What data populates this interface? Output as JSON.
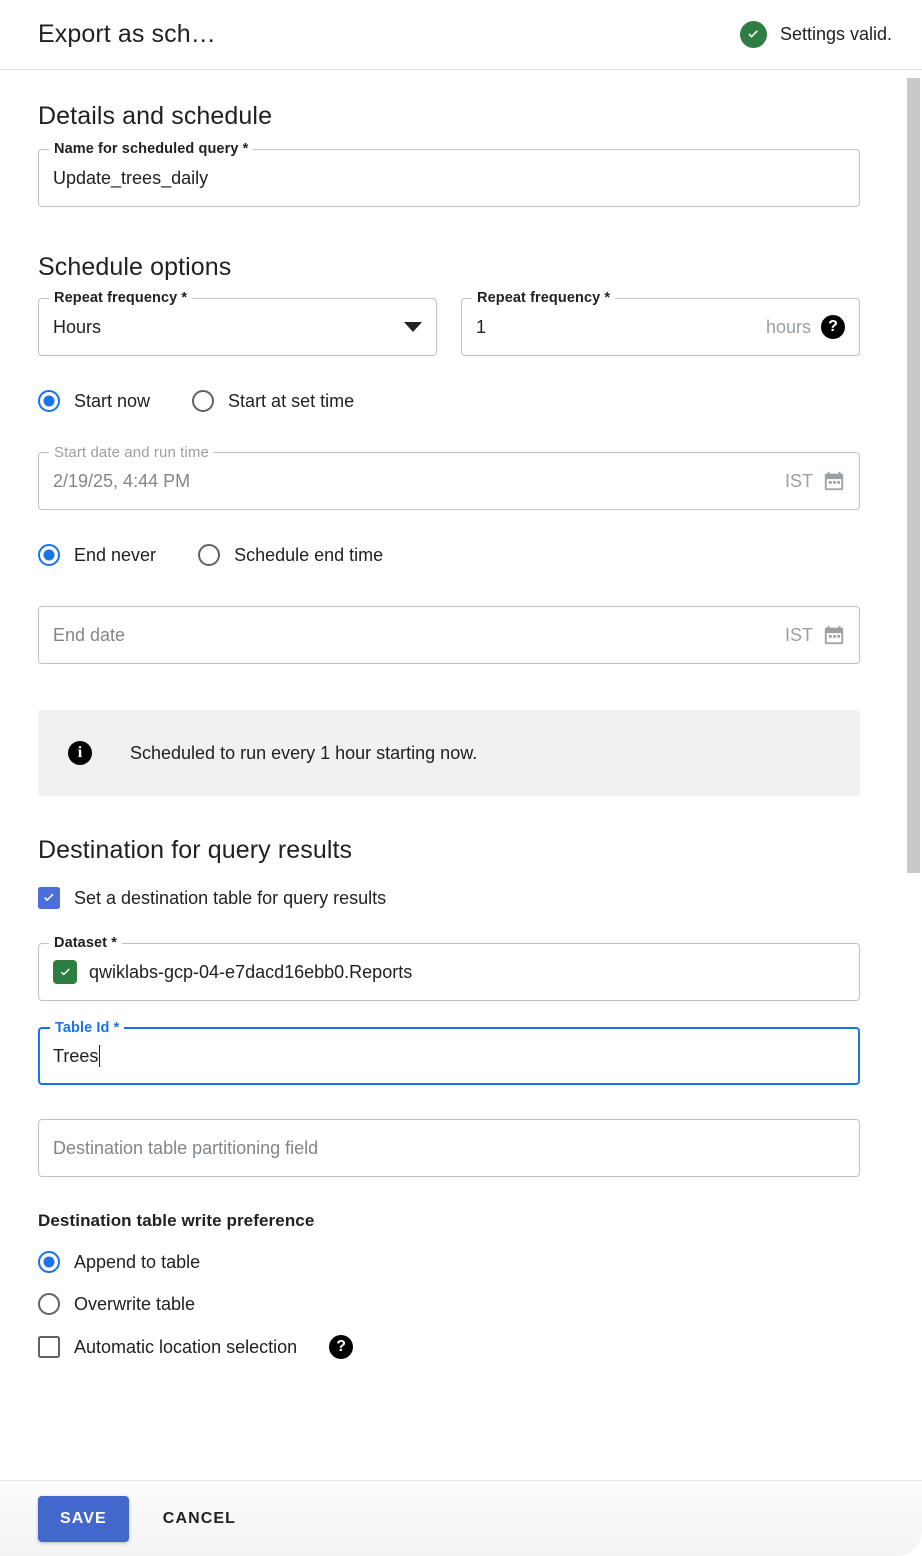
{
  "header": {
    "title": "Export as sch…",
    "status_text": "Settings valid.",
    "status_color": "#2e7d43"
  },
  "details": {
    "section_title": "Details and schedule",
    "name_field": {
      "label": "Name for scheduled query *",
      "value": "Update_trees_daily"
    }
  },
  "schedule": {
    "section_title": "Schedule options",
    "repeat_unit": {
      "label": "Repeat frequency *",
      "value": "Hours"
    },
    "repeat_value": {
      "label": "Repeat frequency *",
      "value": "1",
      "suffix": "hours",
      "help": "?"
    },
    "start_radios": [
      {
        "label": "Start now",
        "selected": true
      },
      {
        "label": "Start at set time",
        "selected": false
      }
    ],
    "start_date_field": {
      "label": "Start date and run time",
      "value": "2/19/25, 4:44 PM",
      "timezone": "IST"
    },
    "end_radios": [
      {
        "label": "End never",
        "selected": true
      },
      {
        "label": "Schedule end time",
        "selected": false
      }
    ],
    "end_date_field": {
      "placeholder": "End date",
      "timezone": "IST"
    },
    "info_banner": "Scheduled to run every 1 hour starting now."
  },
  "destination": {
    "section_title": "Destination for query results",
    "set_destination_checkbox": {
      "label": "Set a destination table for query results",
      "checked": true
    },
    "dataset_field": {
      "label": "Dataset *",
      "value": "qwiklabs-gcp-04-e7dacd16ebb0.Reports"
    },
    "table_id_field": {
      "label": "Table Id *",
      "value": "Trees",
      "focused": true
    },
    "partitioning_field": {
      "placeholder": "Destination table partitioning field"
    },
    "write_preference_label": "Destination table write preference",
    "write_preference_radios": [
      {
        "label": "Append to table",
        "selected": true
      },
      {
        "label": "Overwrite table",
        "selected": false
      }
    ],
    "auto_location_checkbox": {
      "label": "Automatic location selection",
      "checked": false,
      "help": "?"
    }
  },
  "footer": {
    "save_label": "SAVE",
    "cancel_label": "CANCEL"
  },
  "colors": {
    "accent_blue": "#1a73e8",
    "save_blue": "#4267cd",
    "green": "#2e7d43"
  }
}
